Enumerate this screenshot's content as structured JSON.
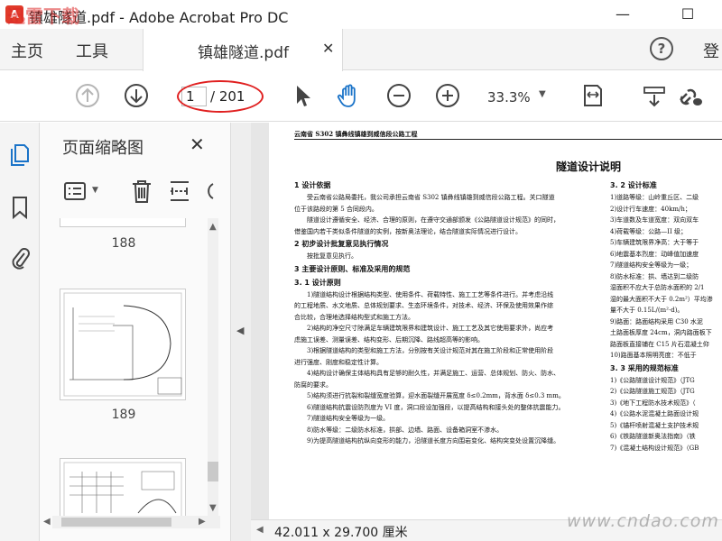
{
  "window": {
    "title": "镇雄隧道.pdf - Adobe Acrobat Pro DC",
    "minimize": "—",
    "maximize": "☐"
  },
  "menu": {
    "home": "主页",
    "tools": "工具",
    "doc_tab": "镇雄隧道.pdf",
    "doc_tab_close": "✕",
    "help": "?",
    "login": "登"
  },
  "toolbar": {
    "page_current": "1",
    "page_total": "/ 201",
    "zoom": "33.3%",
    "icons": [
      "prev-page",
      "next-page",
      "select-arrow",
      "hand-tool",
      "zoom-out",
      "zoom-in",
      "fit-page",
      "scroll-mode",
      "share-link"
    ],
    "annotation_color": "#e02020"
  },
  "left_rail": {
    "icons": [
      "pages-thumbnail",
      "bookmark",
      "attachment"
    ],
    "accent": "#1a73c8"
  },
  "thumb_panel": {
    "title": "页面缩略图",
    "close": "✕",
    "pages": [
      {
        "label": "188"
      },
      {
        "label": "189"
      }
    ]
  },
  "document": {
    "header": "云南省 S302 镇彝线镇雄到威信段公路工程",
    "title": "隧道设计说明",
    "left_column": [
      {
        "type": "head",
        "text": "1 设计依据"
      },
      {
        "type": "line",
        "indent": true,
        "text": "受云南省公路局委托，我公司承担云南省 S302 镇彝线镇雄到威信段公路工程。关口隧道"
      },
      {
        "type": "line",
        "indent": false,
        "text": "位于该路段的第 5 合同段内。"
      },
      {
        "type": "line",
        "indent": true,
        "text": "隧道设计遵循安全、经济、合理的原则，在遵守交通部颁发《公路隧道设计规范》的同时，"
      },
      {
        "type": "line",
        "indent": false,
        "text": "借鉴国内若干类似条件隧道的实例，按新奥法理论，结合隧道实际情况进行设计。"
      },
      {
        "type": "head",
        "text": "2 初步设计批复意见执行情况"
      },
      {
        "type": "line",
        "indent": true,
        "text": "按批复意见执行。"
      },
      {
        "type": "head",
        "text": "3 主要设计原则、标准及采用的规范"
      },
      {
        "type": "head",
        "text": "3. 1 设计原则"
      },
      {
        "type": "line",
        "indent": true,
        "text": "1)隧道结构设计根据结构类型、使用条件、荷载特性、施工工艺等条件进行。并考虑沿线"
      },
      {
        "type": "line",
        "indent": false,
        "text": "的工程地质、水文地质、总体规划要求、生态环境条件，对技术、经济、环保及使用效果作综"
      },
      {
        "type": "line",
        "indent": false,
        "text": "合比较，合理地选择结构型式和施工方法。"
      },
      {
        "type": "line",
        "indent": true,
        "text": "2)结构的净空尺寸除满足车辆建筑限界和建筑设计、施工工艺及其它使用要求外，尚应考"
      },
      {
        "type": "line",
        "indent": false,
        "text": "虑施工误差、测量误差、结构变形、后期沉降、路线超高等的影响。"
      },
      {
        "type": "line",
        "indent": true,
        "text": "3)根据隧道结构的类型和施工方法，分别按有关设计规范对其在施工阶段和正常使用阶段"
      },
      {
        "type": "line",
        "indent": false,
        "text": "进行强度、刚度和稳定性计算。"
      },
      {
        "type": "line",
        "indent": true,
        "text": "4)结构设计确保主体结构具有足够的耐久性，并满足施工、运营、总体规划、防火、防水、"
      },
      {
        "type": "line",
        "indent": false,
        "text": "防腐的要求。"
      },
      {
        "type": "line",
        "indent": true,
        "text": "5)结构须进行抗裂和裂缝宽度验算，迎水面裂缝开展宽度 δ≤0.2mm，背水面 δ≤0.3 mm。"
      },
      {
        "type": "line",
        "indent": true,
        "text": "6)隧道结构抗震设防烈度为 VI 度，洞口段设加强段，以提高结构和接头处的整体抗震能力。"
      },
      {
        "type": "line",
        "indent": true,
        "text": "7)隧道结构安全等级为一级。"
      },
      {
        "type": "line",
        "indent": true,
        "text": "8)防水等级：二级防水标准，拱部、边墙、路面、设备箱洞室不渗水。"
      },
      {
        "type": "line",
        "indent": true,
        "text": "9)为提高隧道结构抗纵向变形的能力，沿隧道长度方向围岩变化、结构突变处设置沉降缝。"
      }
    ],
    "right_column": [
      {
        "type": "head",
        "text": "3. 2 设计标准"
      },
      {
        "type": "line",
        "text": "1)道路等级：山岭重丘区、二级"
      },
      {
        "type": "line",
        "text": "2)设计行车速度：40km/h；"
      },
      {
        "type": "line",
        "text": "3)车道数及车道宽度：双向双车"
      },
      {
        "type": "line",
        "text": "4)荷载等级：公路—II 级；"
      },
      {
        "type": "line",
        "text": "5)车辆建筑限界净高：大于等于"
      },
      {
        "type": "line",
        "text": "6)地震基本烈度：动峰值加速度"
      },
      {
        "type": "line",
        "text": "7)隧道结构安全等级为一级；"
      },
      {
        "type": "line",
        "text": "8)防水标准：拱、墙达到二级防"
      },
      {
        "type": "line",
        "text": "湿面积不应大于总防水面积的 2/1"
      },
      {
        "type": "line",
        "text": "湿的最大面积不大于 0.2m²）平均渗"
      },
      {
        "type": "line",
        "text": "量不大于 0.15L/(m²·d)。"
      },
      {
        "type": "line",
        "text": "9)路面：路面结构采用 C30 水泥"
      },
      {
        "type": "line",
        "text": "土路面板厚度 24cm，洞内路面板下"
      },
      {
        "type": "line",
        "text": "路面板直接铺在 C15 片石混凝土仰"
      },
      {
        "type": "line",
        "text": "10)路面基本照明亮度：不低于"
      },
      {
        "type": "head",
        "text": "3. 3 采用的规范标准"
      },
      {
        "type": "line",
        "text": "1)《公路隧道设计规范》（JTG"
      },
      {
        "type": "line",
        "text": "2)《公路隧道施工规范》（JTG"
      },
      {
        "type": "line",
        "text": "3)《地下工程防水技术规范》（"
      },
      {
        "type": "line",
        "text": "4)《公路水泥混凝土路面设计规"
      },
      {
        "type": "line",
        "text": "5)《锚杆喷射混凝土支护技术规"
      },
      {
        "type": "line",
        "text": "6)《铁路隧道新奥法指南》（铁"
      },
      {
        "type": "line",
        "text": "7)《混凝土结构设计规范》（GB"
      }
    ]
  },
  "statusbar": {
    "page_size": "42.011 x 29.700 厘米"
  },
  "watermarks": {
    "top": "迅雷下载",
    "bottom": "www.cndao.com"
  }
}
